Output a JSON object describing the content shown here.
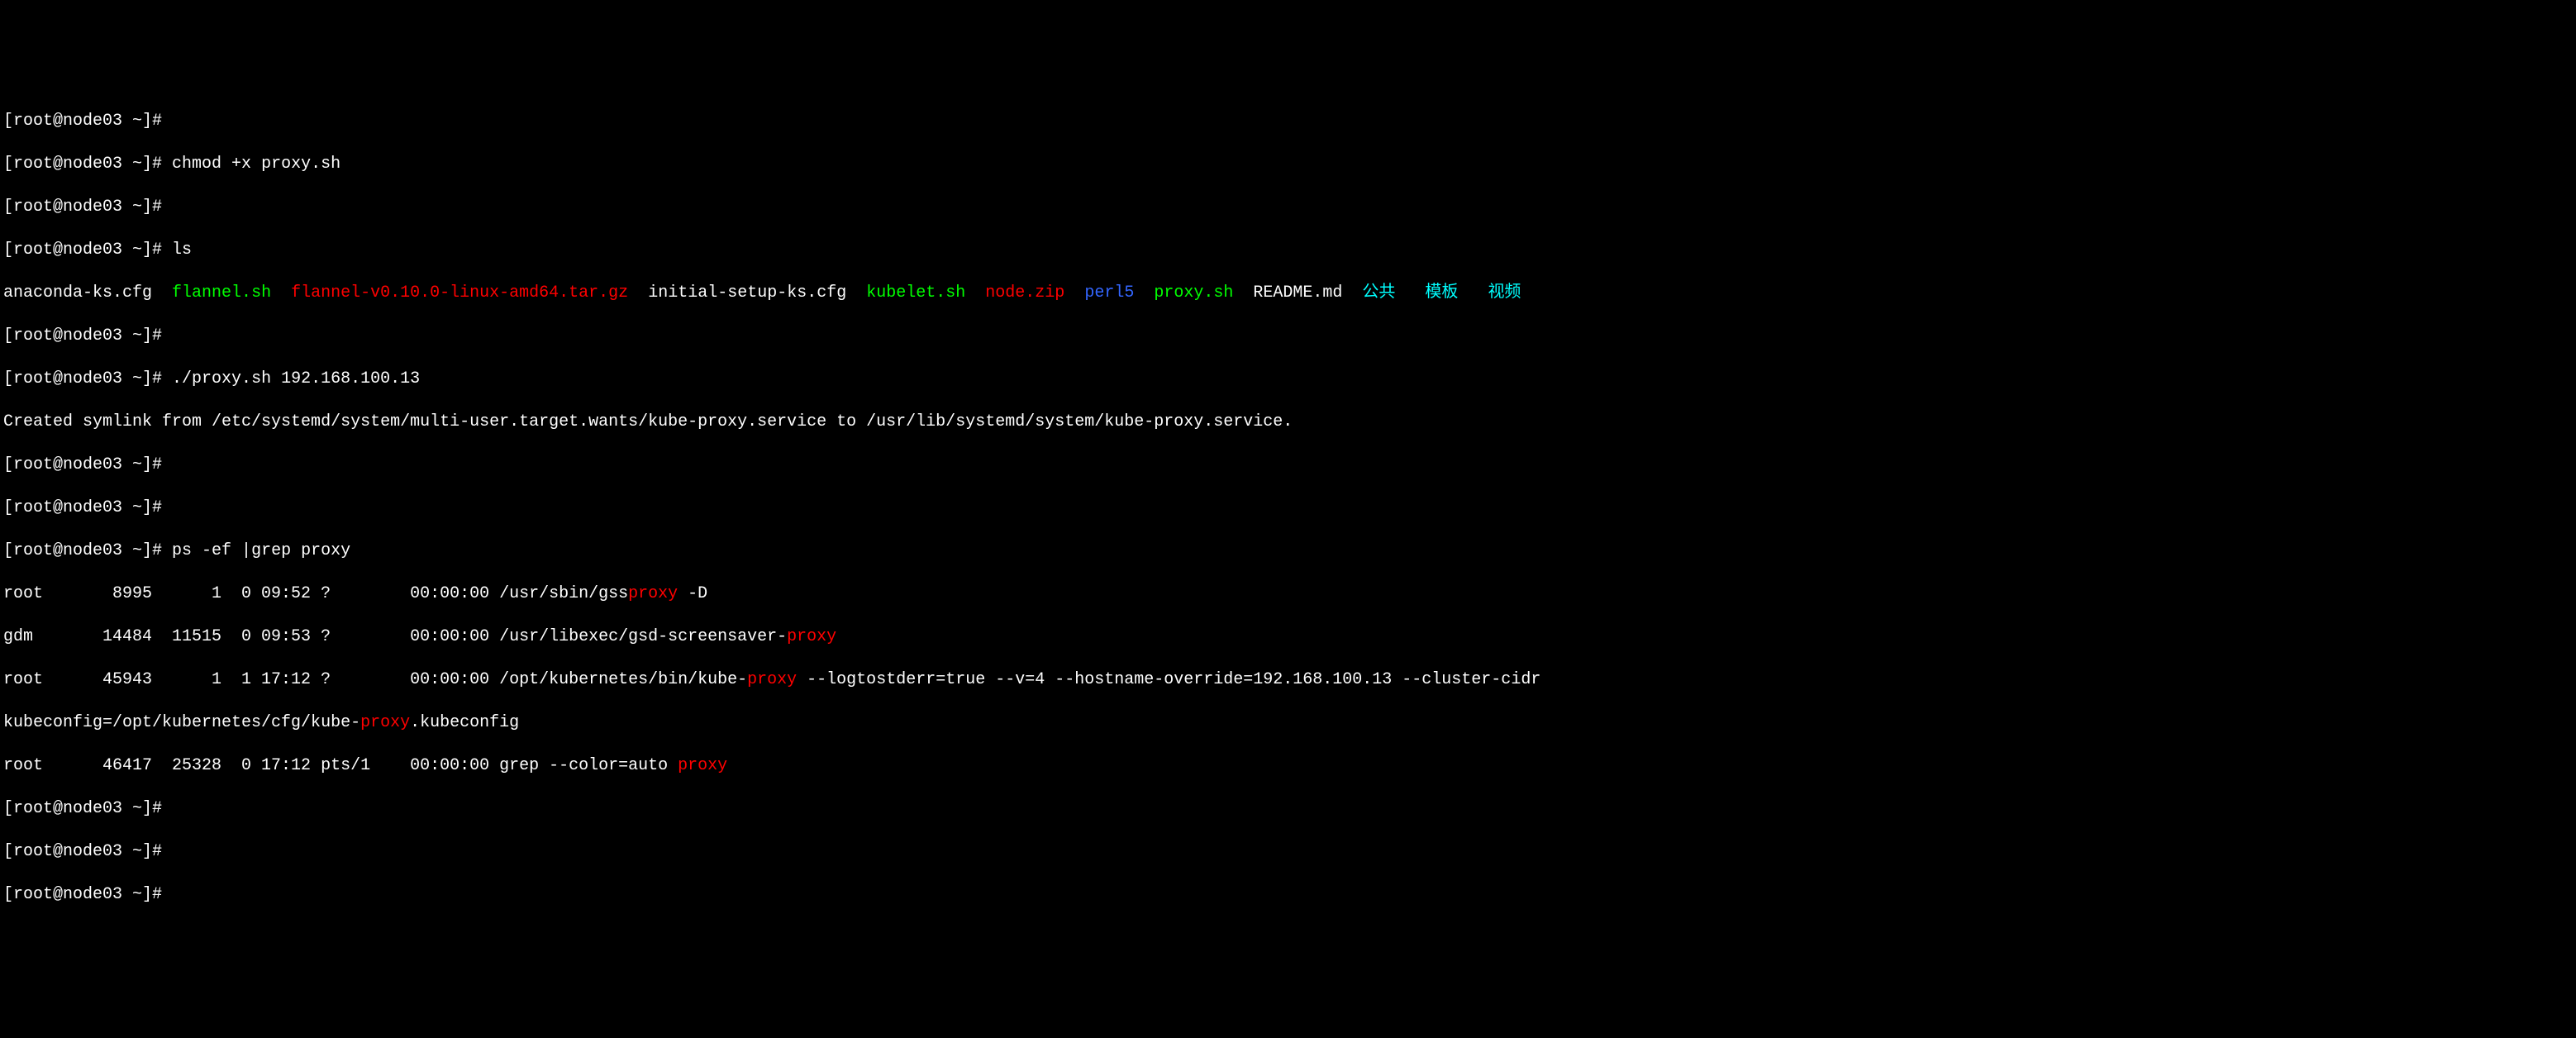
{
  "lines": {
    "l0": "[root@node03 ~]#",
    "l1_prompt": "[root@node03 ~]# ",
    "l1_cmd": "chmod +x proxy.sh",
    "l2": "[root@node03 ~]#",
    "l3_prompt": "[root@node03 ~]# ",
    "l3_cmd": "ls",
    "l4_f1": "anaconda-ks.cfg  ",
    "l4_f2": "flannel.sh",
    "l4_sp2": "  ",
    "l4_f3": "flannel-v0.10.0-linux-amd64.tar.gz",
    "l4_sp3": "  ",
    "l4_f4": "initial-setup-ks.cfg  ",
    "l4_f5": "kubelet.sh",
    "l4_sp5": "  ",
    "l4_f6": "node.zip",
    "l4_sp6": "  ",
    "l4_f7": "perl5",
    "l4_sp7": "  ",
    "l4_f8": "proxy.sh",
    "l4_sp8": "  ",
    "l4_f9": "README.md  ",
    "l4_f10": "公共",
    "l4_sp10": "   ",
    "l4_f11": "模板",
    "l4_sp11": "   ",
    "l4_f12": "视频",
    "l5": "[root@node03 ~]#",
    "l6_prompt": "[root@node03 ~]# ",
    "l6_cmd": "./proxy.sh 192.168.100.13",
    "l7": "Created symlink from /etc/systemd/system/multi-user.target.wants/kube-proxy.service to /usr/lib/systemd/system/kube-proxy.service.",
    "l8": "[root@node03 ~]#",
    "l9": "[root@node03 ~]#",
    "l10_prompt": "[root@node03 ~]# ",
    "l10_cmd": "ps -ef |grep proxy",
    "l11_a": "root       8995      1  0 09:52 ?        00:00:00 /usr/sbin/gss",
    "l11_b": "proxy",
    "l11_c": " -D",
    "l12_a": "gdm       14484  11515  0 09:53 ?        00:00:00 /usr/libexec/gsd-screensaver-",
    "l12_b": "proxy",
    "l13_a": "root      45943      1  1 17:12 ?        00:00:00 /opt/kubernetes/bin/kube-",
    "l13_b": "proxy",
    "l13_c": " --logtostderr=true --v=4 --hostname-override=192.168.100.13 --cluster-cidr",
    "l14_a": "kubeconfig=/opt/kubernetes/cfg/kube-",
    "l14_b": "proxy",
    "l14_c": ".kubeconfig",
    "l15_a": "root      46417  25328  0 17:12 pts/1    00:00:00 grep --color=auto ",
    "l15_b": "proxy",
    "l16": "[root@node03 ~]#",
    "l17": "[root@node03 ~]#",
    "l18": "[root@node03 ~]#"
  }
}
